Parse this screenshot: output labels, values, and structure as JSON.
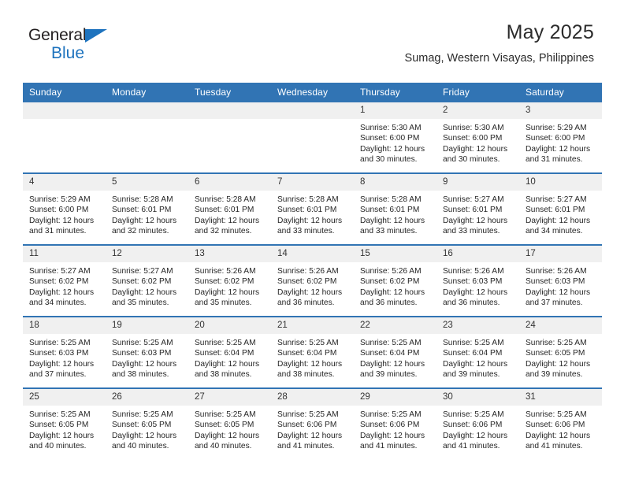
{
  "brand": {
    "name_part1": "General",
    "name_part2": "Blue",
    "accent_color": "#1e73be"
  },
  "header": {
    "month_title": "May 2025",
    "location": "Sumag, Western Visayas, Philippines"
  },
  "theme": {
    "header_blue": "#3174b4",
    "daynum_band": "#f0f0f0",
    "text": "#262626"
  },
  "labels": {
    "sunrise_prefix": "Sunrise:",
    "sunset_prefix": "Sunset:",
    "daylight_prefix": "Daylight:"
  },
  "weekday_headers": [
    "Sunday",
    "Monday",
    "Tuesday",
    "Wednesday",
    "Thursday",
    "Friday",
    "Saturday"
  ],
  "weeks": [
    [
      {
        "day": "",
        "empty": true
      },
      {
        "day": "",
        "empty": true
      },
      {
        "day": "",
        "empty": true
      },
      {
        "day": "",
        "empty": true
      },
      {
        "day": "1",
        "sunrise": "Sunrise: 5:30 AM",
        "sunset": "Sunset: 6:00 PM",
        "daylight": "Daylight: 12 hours and 30 minutes."
      },
      {
        "day": "2",
        "sunrise": "Sunrise: 5:30 AM",
        "sunset": "Sunset: 6:00 PM",
        "daylight": "Daylight: 12 hours and 30 minutes."
      },
      {
        "day": "3",
        "sunrise": "Sunrise: 5:29 AM",
        "sunset": "Sunset: 6:00 PM",
        "daylight": "Daylight: 12 hours and 31 minutes."
      }
    ],
    [
      {
        "day": "4",
        "sunrise": "Sunrise: 5:29 AM",
        "sunset": "Sunset: 6:00 PM",
        "daylight": "Daylight: 12 hours and 31 minutes."
      },
      {
        "day": "5",
        "sunrise": "Sunrise: 5:28 AM",
        "sunset": "Sunset: 6:01 PM",
        "daylight": "Daylight: 12 hours and 32 minutes."
      },
      {
        "day": "6",
        "sunrise": "Sunrise: 5:28 AM",
        "sunset": "Sunset: 6:01 PM",
        "daylight": "Daylight: 12 hours and 32 minutes."
      },
      {
        "day": "7",
        "sunrise": "Sunrise: 5:28 AM",
        "sunset": "Sunset: 6:01 PM",
        "daylight": "Daylight: 12 hours and 33 minutes."
      },
      {
        "day": "8",
        "sunrise": "Sunrise: 5:28 AM",
        "sunset": "Sunset: 6:01 PM",
        "daylight": "Daylight: 12 hours and 33 minutes."
      },
      {
        "day": "9",
        "sunrise": "Sunrise: 5:27 AM",
        "sunset": "Sunset: 6:01 PM",
        "daylight": "Daylight: 12 hours and 33 minutes."
      },
      {
        "day": "10",
        "sunrise": "Sunrise: 5:27 AM",
        "sunset": "Sunset: 6:01 PM",
        "daylight": "Daylight: 12 hours and 34 minutes."
      }
    ],
    [
      {
        "day": "11",
        "sunrise": "Sunrise: 5:27 AM",
        "sunset": "Sunset: 6:02 PM",
        "daylight": "Daylight: 12 hours and 34 minutes."
      },
      {
        "day": "12",
        "sunrise": "Sunrise: 5:27 AM",
        "sunset": "Sunset: 6:02 PM",
        "daylight": "Daylight: 12 hours and 35 minutes."
      },
      {
        "day": "13",
        "sunrise": "Sunrise: 5:26 AM",
        "sunset": "Sunset: 6:02 PM",
        "daylight": "Daylight: 12 hours and 35 minutes."
      },
      {
        "day": "14",
        "sunrise": "Sunrise: 5:26 AM",
        "sunset": "Sunset: 6:02 PM",
        "daylight": "Daylight: 12 hours and 36 minutes."
      },
      {
        "day": "15",
        "sunrise": "Sunrise: 5:26 AM",
        "sunset": "Sunset: 6:02 PM",
        "daylight": "Daylight: 12 hours and 36 minutes."
      },
      {
        "day": "16",
        "sunrise": "Sunrise: 5:26 AM",
        "sunset": "Sunset: 6:03 PM",
        "daylight": "Daylight: 12 hours and 36 minutes."
      },
      {
        "day": "17",
        "sunrise": "Sunrise: 5:26 AM",
        "sunset": "Sunset: 6:03 PM",
        "daylight": "Daylight: 12 hours and 37 minutes."
      }
    ],
    [
      {
        "day": "18",
        "sunrise": "Sunrise: 5:25 AM",
        "sunset": "Sunset: 6:03 PM",
        "daylight": "Daylight: 12 hours and 37 minutes."
      },
      {
        "day": "19",
        "sunrise": "Sunrise: 5:25 AM",
        "sunset": "Sunset: 6:03 PM",
        "daylight": "Daylight: 12 hours and 38 minutes."
      },
      {
        "day": "20",
        "sunrise": "Sunrise: 5:25 AM",
        "sunset": "Sunset: 6:04 PM",
        "daylight": "Daylight: 12 hours and 38 minutes."
      },
      {
        "day": "21",
        "sunrise": "Sunrise: 5:25 AM",
        "sunset": "Sunset: 6:04 PM",
        "daylight": "Daylight: 12 hours and 38 minutes."
      },
      {
        "day": "22",
        "sunrise": "Sunrise: 5:25 AM",
        "sunset": "Sunset: 6:04 PM",
        "daylight": "Daylight: 12 hours and 39 minutes."
      },
      {
        "day": "23",
        "sunrise": "Sunrise: 5:25 AM",
        "sunset": "Sunset: 6:04 PM",
        "daylight": "Daylight: 12 hours and 39 minutes."
      },
      {
        "day": "24",
        "sunrise": "Sunrise: 5:25 AM",
        "sunset": "Sunset: 6:05 PM",
        "daylight": "Daylight: 12 hours and 39 minutes."
      }
    ],
    [
      {
        "day": "25",
        "sunrise": "Sunrise: 5:25 AM",
        "sunset": "Sunset: 6:05 PM",
        "daylight": "Daylight: 12 hours and 40 minutes."
      },
      {
        "day": "26",
        "sunrise": "Sunrise: 5:25 AM",
        "sunset": "Sunset: 6:05 PM",
        "daylight": "Daylight: 12 hours and 40 minutes."
      },
      {
        "day": "27",
        "sunrise": "Sunrise: 5:25 AM",
        "sunset": "Sunset: 6:05 PM",
        "daylight": "Daylight: 12 hours and 40 minutes."
      },
      {
        "day": "28",
        "sunrise": "Sunrise: 5:25 AM",
        "sunset": "Sunset: 6:06 PM",
        "daylight": "Daylight: 12 hours and 41 minutes."
      },
      {
        "day": "29",
        "sunrise": "Sunrise: 5:25 AM",
        "sunset": "Sunset: 6:06 PM",
        "daylight": "Daylight: 12 hours and 41 minutes."
      },
      {
        "day": "30",
        "sunrise": "Sunrise: 5:25 AM",
        "sunset": "Sunset: 6:06 PM",
        "daylight": "Daylight: 12 hours and 41 minutes."
      },
      {
        "day": "31",
        "sunrise": "Sunrise: 5:25 AM",
        "sunset": "Sunset: 6:06 PM",
        "daylight": "Daylight: 12 hours and 41 minutes."
      }
    ]
  ]
}
